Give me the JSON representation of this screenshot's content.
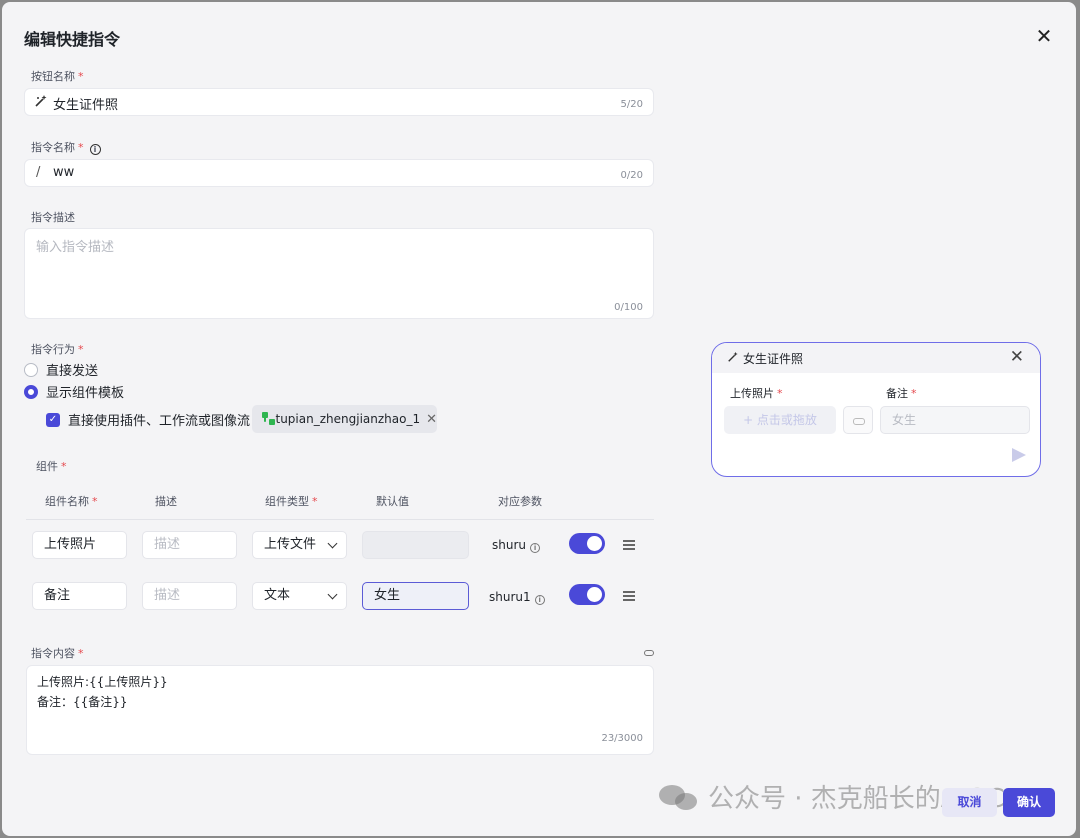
{
  "dialog": {
    "title": "编辑快捷指令",
    "close_glyph": "✕"
  },
  "button_name": {
    "label": "按钮名称",
    "required": "*",
    "value": "女生证件照",
    "counter": "5/20",
    "icon": "magic-wand-icon"
  },
  "command_name": {
    "label": "指令名称",
    "required": "*",
    "prefix": "/",
    "value": "ww",
    "counter": "0/20"
  },
  "command_desc": {
    "label": "指令描述",
    "placeholder": "输入指令描述",
    "counter": "0/100"
  },
  "behavior": {
    "label": "指令行为",
    "required": "*",
    "options": [
      "直接发送",
      "显示组件模板"
    ],
    "selected": "显示组件模板",
    "checkbox_label": "直接使用插件、工作流或图像流",
    "checkbox_checked": true,
    "plugin_chip": "tupian_zhengjianzhao_1",
    "chip_close": "✕"
  },
  "components": {
    "label": "组件",
    "required": "*",
    "headers": [
      "组件名称",
      "描述",
      "组件类型",
      "默认值",
      "对应参数"
    ],
    "header_required": [
      "*",
      "",
      "*",
      "",
      ""
    ],
    "rows": [
      {
        "name": "上传照片",
        "desc_placeholder": "描述",
        "type": "上传文件",
        "default": "",
        "param": "shuru",
        "enabled": true
      },
      {
        "name": "备注",
        "desc_placeholder": "描述",
        "type": "文本",
        "default": "女生",
        "param": "shuru1",
        "enabled": true
      }
    ]
  },
  "content": {
    "label": "指令内容",
    "required": "*",
    "lines": [
      "上传照片:{{上传照片}}",
      "备注：{{备注}}"
    ],
    "counter": "23/3000"
  },
  "preview": {
    "title": "女生证件照",
    "close_glyph": "✕",
    "field1_label": "上传照片",
    "field2_label": "备注",
    "required": "*",
    "upload_text": "+ 点击或拖放",
    "note_value": "女生"
  },
  "footer": {
    "cancel": "取消",
    "confirm": "确认"
  },
  "watermark": "公众号 · 杰克船长的AIGC",
  "colors": {
    "accent": "#4a49d8",
    "required": "#e5484d",
    "workflow_green": "#2fb550"
  }
}
